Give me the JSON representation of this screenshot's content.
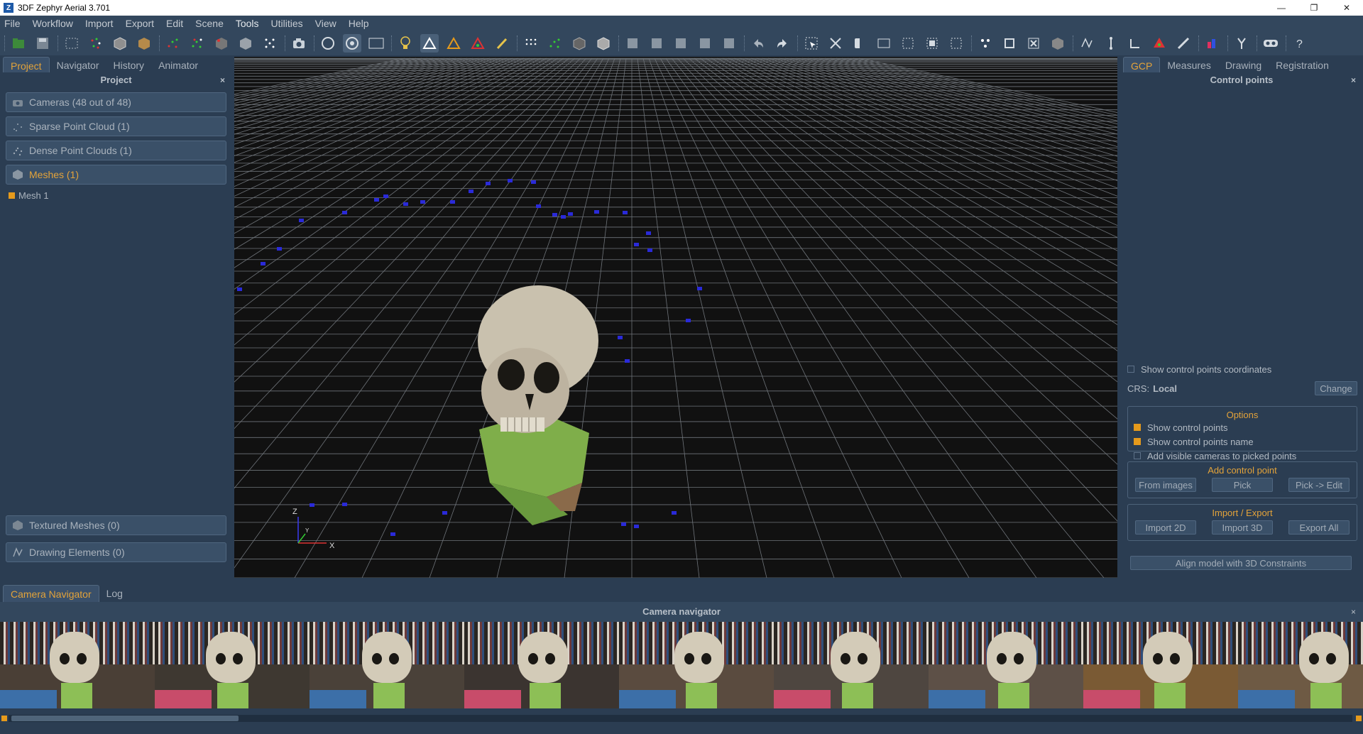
{
  "window": {
    "title": "3DF Zephyr Aerial 3.701",
    "app_icon_letter": "Z",
    "minimize": "—",
    "restore": "❐",
    "close": "✕"
  },
  "menu": [
    "File",
    "Workflow",
    "Import",
    "Export",
    "Edit",
    "Scene",
    "Tools",
    "Utilities",
    "View",
    "Help"
  ],
  "left": {
    "tabs": [
      "Project",
      "Navigator",
      "History",
      "Animator"
    ],
    "panel_title": "Project",
    "close": "×",
    "groups": [
      {
        "label": "Cameras (48 out of 48)",
        "icon": "camera-icon"
      },
      {
        "label": "Sparse Point Cloud (1)",
        "icon": "sparse-cloud-icon"
      },
      {
        "label": "Dense Point Clouds (1)",
        "icon": "dense-cloud-icon"
      },
      {
        "label": "Meshes (1)",
        "icon": "mesh-icon"
      }
    ],
    "mesh_item": "Mesh 1",
    "bottom_groups": [
      {
        "label": "Textured Meshes (0)",
        "icon": "textured-mesh-icon"
      },
      {
        "label": "Drawing Elements (0)",
        "icon": "drawing-icon"
      }
    ]
  },
  "viewport": {
    "axis_z": "Z",
    "axis_x": "X",
    "axis_y": "Y"
  },
  "right": {
    "tabs": [
      "GCP",
      "Measures",
      "Drawing",
      "Registration"
    ],
    "panel_title": "Control points",
    "close": "×",
    "show_coords": "Show control points coordinates",
    "crs_label": "CRS:",
    "crs_value": "Local",
    "change_button": "Change",
    "options": {
      "legend": "Options",
      "show_points": "Show control points",
      "show_names": "Show control points name",
      "add_cameras": "Add visible cameras to picked points"
    },
    "add_cp": {
      "legend": "Add control point",
      "from_images": "From images",
      "pick": "Pick",
      "pick_edit": "Pick -> Edit"
    },
    "import_export": {
      "legend": "Import / Export",
      "import2d": "Import 2D",
      "import3d": "Import 3D",
      "export_all": "Export All"
    },
    "align_button": "Align model with 3D Constraints"
  },
  "bottom": {
    "tabs": [
      "Camera Navigator",
      "Log"
    ],
    "title": "Camera navigator",
    "close": "×"
  },
  "colors": {
    "accent": "#e3a33a",
    "panel": "#2b3d52",
    "toolbar": "#33475d",
    "viewport": "#111111",
    "camera_marker": "#2a2ad8"
  }
}
